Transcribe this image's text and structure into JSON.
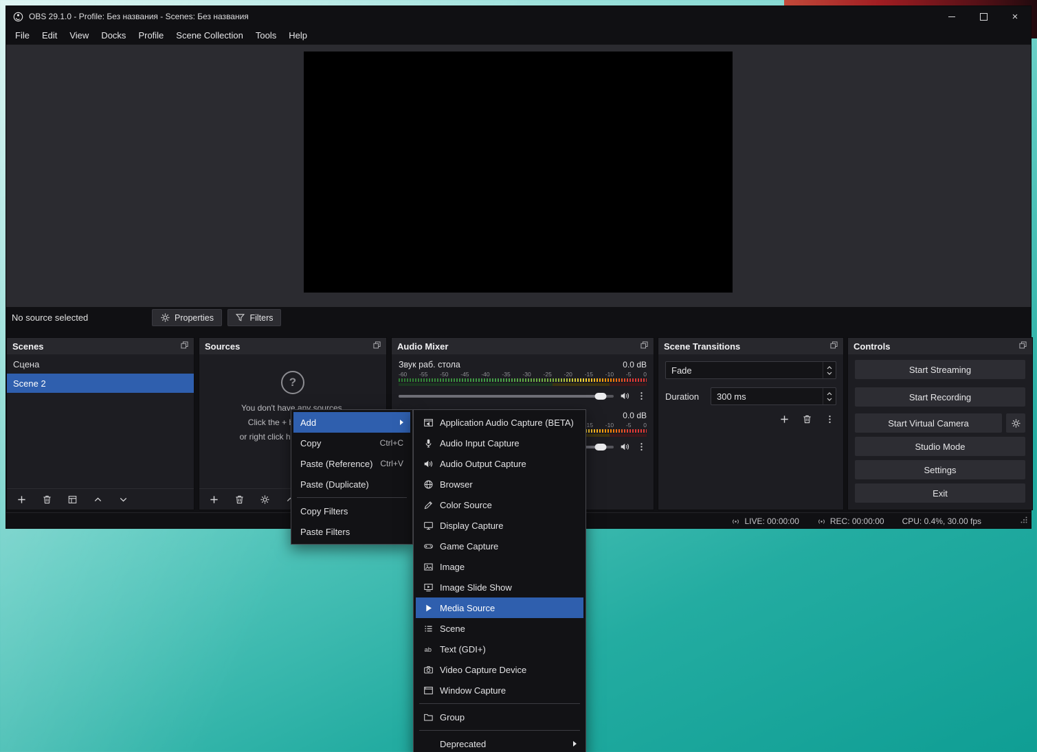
{
  "titlebar": {
    "title": "OBS 29.1.0 - Profile: Без названия - Scenes: Без названия"
  },
  "menubar": {
    "items": [
      "File",
      "Edit",
      "View",
      "Docks",
      "Profile",
      "Scene Collection",
      "Tools",
      "Help"
    ]
  },
  "source_toolbar": {
    "status": "No source selected",
    "properties": "Properties",
    "filters": "Filters"
  },
  "scenes": {
    "title": "Scenes",
    "items": [
      {
        "label": "Сцена",
        "selected": false
      },
      {
        "label": "Scene 2",
        "selected": true
      }
    ]
  },
  "sources": {
    "title": "Sources",
    "empty_icon": "question-ghost-icon",
    "empty_mark": "?",
    "empty_text": [
      "You don't have any sources.",
      "Click the + button below,",
      "or right click here to add one."
    ]
  },
  "mixer": {
    "title": "Audio Mixer",
    "ticks": [
      "-60",
      "-55",
      "-50",
      "-45",
      "-40",
      "-35",
      "-30",
      "-25",
      "-20",
      "-15",
      "-10",
      "-5",
      "0"
    ],
    "source1": {
      "name": "Звук раб. стола",
      "db": "0.0 dB"
    },
    "source2": {
      "name": "",
      "db": "0.0 dB"
    }
  },
  "transitions": {
    "title": "Scene Transitions",
    "value": "Fade",
    "duration_label": "Duration",
    "duration": "300 ms"
  },
  "controls": {
    "title": "Controls",
    "stream": "Start Streaming",
    "record": "Start Recording",
    "vcam": "Start Virtual Camera",
    "studio": "Studio Mode",
    "settings": "Settings",
    "exit": "Exit"
  },
  "statusbar": {
    "live": "LIVE: 00:00:00",
    "rec": "REC: 00:00:00",
    "cpu": "CPU: 0.4%, 30.00 fps"
  },
  "context_menu": {
    "items": [
      {
        "label": "Add",
        "shortcut": "",
        "submenu": true,
        "highlighted": true
      },
      {
        "label": "Copy",
        "shortcut": "Ctrl+C"
      },
      {
        "label": "Paste (Reference)",
        "shortcut": "Ctrl+V"
      },
      {
        "label": "Paste (Duplicate)",
        "shortcut": ""
      },
      {
        "label": "Copy Filters",
        "shortcut": ""
      },
      {
        "label": "Paste Filters",
        "shortcut": ""
      }
    ]
  },
  "add_menu": {
    "highlighted": "Media Source",
    "items": [
      {
        "label": "Application Audio Capture (BETA)",
        "icon": "app-audio-icon"
      },
      {
        "label": "Audio Input Capture",
        "icon": "microphone-icon"
      },
      {
        "label": "Audio Output Capture",
        "icon": "speaker-icon"
      },
      {
        "label": "Browser",
        "icon": "globe-icon"
      },
      {
        "label": "Color Source",
        "icon": "pencil-icon"
      },
      {
        "label": "Display Capture",
        "icon": "monitor-icon"
      },
      {
        "label": "Game Capture",
        "icon": "gamepad-icon"
      },
      {
        "label": "Image",
        "icon": "image-icon"
      },
      {
        "label": "Image Slide Show",
        "icon": "slideshow-icon"
      },
      {
        "label": "Media Source",
        "icon": "play-icon"
      },
      {
        "label": "Scene",
        "icon": "list-icon"
      },
      {
        "label": "Text (GDI+)",
        "icon": "text-icon"
      },
      {
        "label": "Video Capture Device",
        "icon": "camera-icon"
      },
      {
        "label": "Window Capture",
        "icon": "window-icon"
      },
      {
        "label": "Group",
        "icon": "folder-icon"
      },
      {
        "label": "Deprecated",
        "icon": "",
        "submenu": true
      }
    ]
  },
  "colors": {
    "accent": "#2f5fae",
    "selection": "#2f5fae",
    "desktop_teal": "#23aca1",
    "desktop_red": "#a01d22"
  }
}
